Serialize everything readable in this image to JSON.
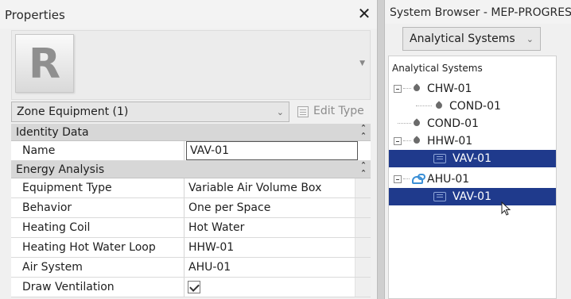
{
  "properties": {
    "title": "Properties",
    "close_glyph": "✕",
    "preview_logo": "R",
    "type_selector": {
      "value": "Zone Equipment (1)"
    },
    "edit_type_label": "Edit Type",
    "categories": [
      {
        "name": "Identity Data",
        "rows": [
          {
            "name": "Name",
            "value": "VAV-01",
            "editing": true
          }
        ]
      },
      {
        "name": "Energy Analysis",
        "rows": [
          {
            "name": "Equipment Type",
            "value": "Variable Air Volume Box"
          },
          {
            "name": "Behavior",
            "value": "One per Space"
          },
          {
            "name": "Heating Coil",
            "value": "Hot Water"
          },
          {
            "name": "Heating Hot Water Loop",
            "value": "HHW-01"
          },
          {
            "name": "Air System",
            "value": "AHU-01"
          },
          {
            "name": "Draw Ventilation",
            "checked": true
          }
        ]
      }
    ]
  },
  "system_browser": {
    "title": "System Browser - MEP-PROGRESS",
    "view_select": {
      "value": "Analytical Systems"
    },
    "tree_header": "Analytical Systems",
    "tree": [
      {
        "label": "CHW-01",
        "level": 0,
        "icon": "water-drop-icon",
        "expanded": true,
        "selected": false
      },
      {
        "label": "COND-01",
        "level": 1,
        "icon": "water-drop-icon",
        "expanded": false,
        "selected": false
      },
      {
        "label": "COND-01",
        "level": 0,
        "icon": "water-drop-icon",
        "expanded": false,
        "selected": false
      },
      {
        "label": "HHW-01",
        "level": 0,
        "icon": "water-drop-icon",
        "expanded": true,
        "selected": false
      },
      {
        "label": "VAV-01",
        "level": 1,
        "icon": "vav-box-icon",
        "expanded": false,
        "selected": true
      },
      {
        "label": "AHU-01",
        "level": 0,
        "icon": "air-handler-icon",
        "expanded": true,
        "selected": false
      },
      {
        "label": "VAV-01",
        "level": 1,
        "icon": "vav-box-icon",
        "expanded": false,
        "selected": true
      }
    ]
  },
  "colors": {
    "selection": "#1f3a8c",
    "category_bg": "#d7d7d7",
    "panel_bg": "#f0f0f0"
  }
}
